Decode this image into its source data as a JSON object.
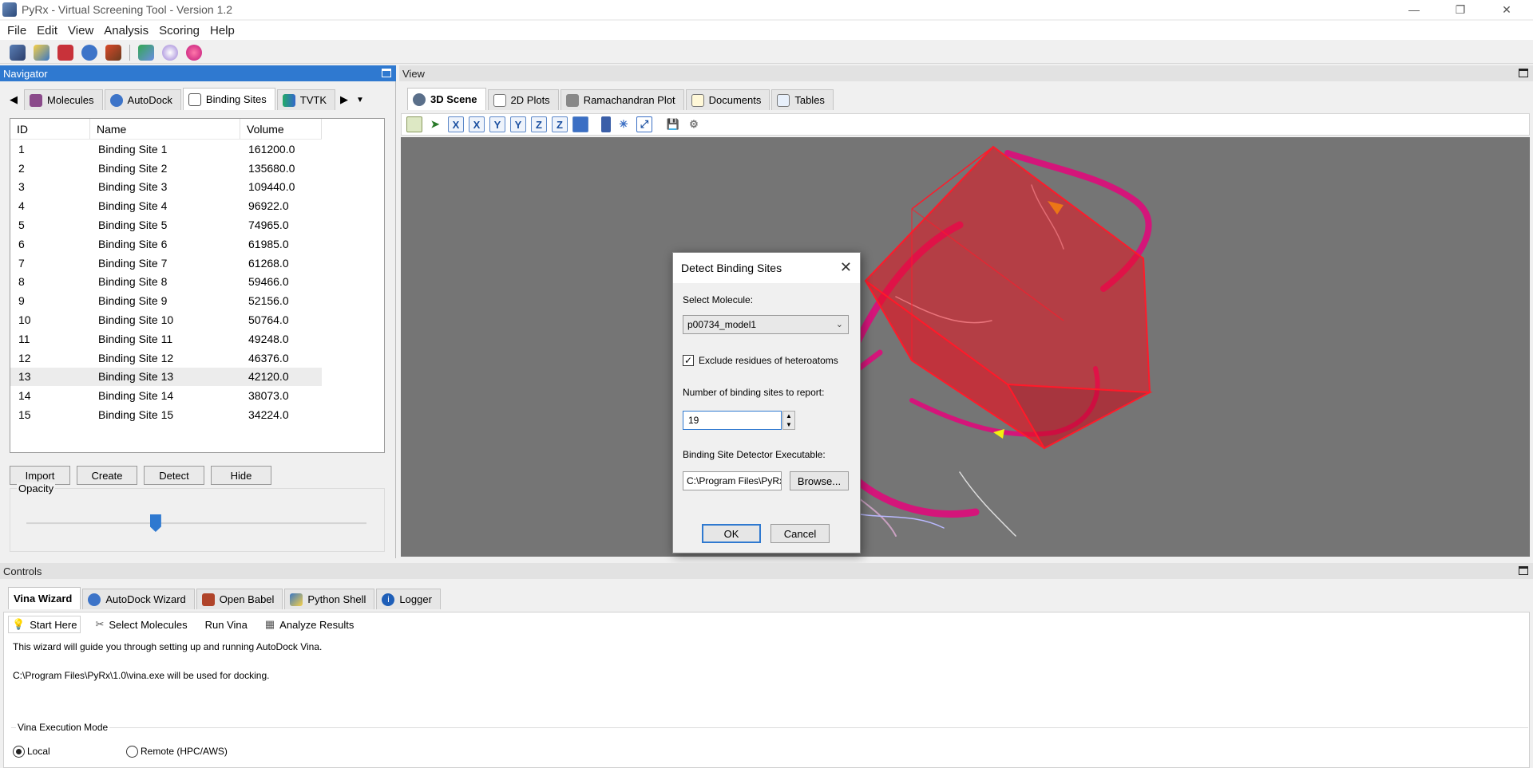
{
  "window": {
    "title": "PyRx - Virtual Screening Tool - Version 1.2",
    "controls": {
      "minimize": "—",
      "restore": "❐",
      "close": "✕"
    }
  },
  "menu": [
    "File",
    "Edit",
    "View",
    "Analysis",
    "Scoring",
    "Help"
  ],
  "navigator": {
    "title": "Navigator",
    "tabs": [
      "Molecules",
      "AutoDock",
      "Binding Sites",
      "TVTK"
    ],
    "columns": [
      "ID",
      "Name",
      "Volume"
    ],
    "rows": [
      {
        "id": "1",
        "name": "Binding Site 1",
        "volume": "161200.0"
      },
      {
        "id": "2",
        "name": "Binding Site 2",
        "volume": "135680.0"
      },
      {
        "id": "3",
        "name": "Binding Site 3",
        "volume": "109440.0"
      },
      {
        "id": "4",
        "name": "Binding Site 4",
        "volume": "96922.0"
      },
      {
        "id": "5",
        "name": "Binding Site 5",
        "volume": "74965.0"
      },
      {
        "id": "6",
        "name": "Binding Site 6",
        "volume": "61985.0"
      },
      {
        "id": "7",
        "name": "Binding Site 7",
        "volume": "61268.0"
      },
      {
        "id": "8",
        "name": "Binding Site 8",
        "volume": "59466.0"
      },
      {
        "id": "9",
        "name": "Binding Site 9",
        "volume": "52156.0"
      },
      {
        "id": "10",
        "name": "Binding Site 10",
        "volume": "50764.0"
      },
      {
        "id": "11",
        "name": "Binding Site 11",
        "volume": "49248.0"
      },
      {
        "id": "12",
        "name": "Binding Site 12",
        "volume": "46376.0"
      },
      {
        "id": "13",
        "name": "Binding Site 13",
        "volume": "42120.0"
      },
      {
        "id": "14",
        "name": "Binding Site 14",
        "volume": "38073.0"
      },
      {
        "id": "15",
        "name": "Binding Site 15",
        "volume": "34224.0"
      }
    ],
    "selected_row": "13",
    "buttons": {
      "import": "Import",
      "create": "Create",
      "detect": "Detect",
      "hide": "Hide"
    },
    "opacity_label": "Opacity",
    "opacity_value": 0.38
  },
  "view": {
    "title": "View",
    "tabs": [
      "3D Scene",
      "2D Plots",
      "Ramachandran Plot",
      "Documents",
      "Tables"
    ],
    "toolbar_axes": [
      "X",
      "X",
      "Y",
      "Y",
      "Z",
      "Z"
    ]
  },
  "dialog": {
    "title": "Detect Binding Sites",
    "close": "✕",
    "select_molecule_label": "Select Molecule:",
    "molecule_value": "p00734_model1",
    "exclude_label": "Exclude residues of heteroatoms",
    "exclude_checked": true,
    "number_label": "Number of binding sites to report:",
    "number_value": "19",
    "executable_label": "Binding Site Detector Executable:",
    "executable_value": "C:\\Program Files\\PyRx",
    "browse": "Browse...",
    "ok": "OK",
    "cancel": "Cancel"
  },
  "controls": {
    "title": "Controls",
    "tabs": [
      "Vina Wizard",
      "AutoDock Wizard",
      "Open Babel",
      "Python Shell",
      "Logger"
    ],
    "wizard_steps": [
      "Start Here",
      "Select Molecules",
      "Run Vina",
      "Analyze Results"
    ],
    "intro_text": "This wizard will guide you through setting up and running AutoDock Vina.",
    "path_text": "C:\\Program Files\\PyRx\\1.0\\vina.exe will be used for docking.",
    "exec_mode_label": "Vina Execution Mode",
    "mode_local": "Local",
    "mode_remote": "Remote (HPC/AWS)",
    "selected_mode": "Local"
  },
  "colors": {
    "accent": "#2f79d0",
    "scene_bg": "#757575",
    "box_red": "#e8101e",
    "protein_magenta": "#d4157a"
  }
}
